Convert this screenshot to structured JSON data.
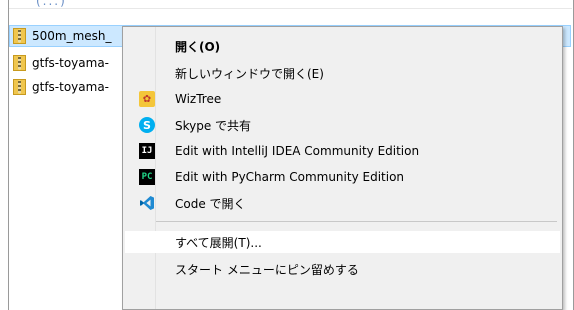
{
  "top_fragment": "(...)",
  "files": [
    {
      "name": "500m_mesh_",
      "selected": true
    },
    {
      "name": "gtfs-toyama-",
      "selected": false
    },
    {
      "name": "gtfs-toyama-",
      "selected": false
    }
  ],
  "menu": {
    "items": [
      {
        "label": "開く(O)",
        "icon": null,
        "bold": true
      },
      {
        "label": "新しいウィンドウで開く(E)",
        "icon": null
      },
      {
        "label": "WizTree",
        "icon": "wiztree-icon"
      },
      {
        "label": "Skype で共有",
        "icon": "skype-icon"
      },
      {
        "label": "Edit with IntelliJ IDEA Community Edition",
        "icon": "intellij-icon"
      },
      {
        "label": "Edit with PyCharm Community Edition",
        "icon": "pycharm-icon"
      },
      {
        "label": "Code で開く",
        "icon": "vscode-icon"
      },
      {
        "label": "すべて展開(T)...",
        "icon": null
      },
      {
        "label": "スタート メニューにピン留めする",
        "icon": null
      }
    ]
  },
  "colors": {
    "selection_bg": "#cce8ff",
    "menu_bg": "#f0f0f0",
    "hover_bg": "#ffffff"
  }
}
